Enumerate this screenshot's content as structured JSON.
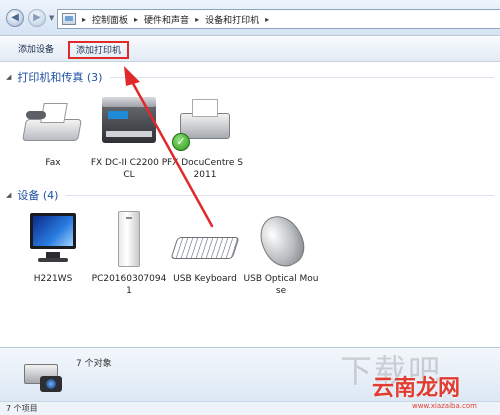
{
  "address_bar": {
    "breadcrumbs": [
      "控制面板",
      "硬件和声音",
      "设备和打印机"
    ]
  },
  "toolbar": {
    "add_device_label": "添加设备",
    "add_printer_label": "添加打印机"
  },
  "groups": {
    "printers": {
      "title": "打印机和传真 (3)",
      "items": [
        {
          "label": "Fax",
          "icon": "fax-icon"
        },
        {
          "label": "FX DC-II C2200 PCL",
          "icon": "multifunction-printer-icon"
        },
        {
          "label": "FX DocuCentre S2011",
          "icon": "printer-icon",
          "default": true
        }
      ]
    },
    "devices": {
      "title": "设备 (4)",
      "items": [
        {
          "label": "H221WS",
          "icon": "monitor-icon"
        },
        {
          "label": "PC201603070941",
          "icon": "computer-tower-icon"
        },
        {
          "label": "USB Keyboard",
          "icon": "keyboard-icon"
        },
        {
          "label": "USB Optical Mouse",
          "icon": "mouse-icon"
        }
      ]
    }
  },
  "details": {
    "count_text": "7 个对象"
  },
  "status_bar": {
    "text": "7 个项目"
  },
  "watermark": {
    "grey_text": "下载吧",
    "red_text": "云南龙网",
    "url_text": "www.xiazaiba.com"
  },
  "colors": {
    "group_title": "#1e50a0",
    "annotation_red": "#e0292b",
    "default_check": "#2c9a1c"
  }
}
